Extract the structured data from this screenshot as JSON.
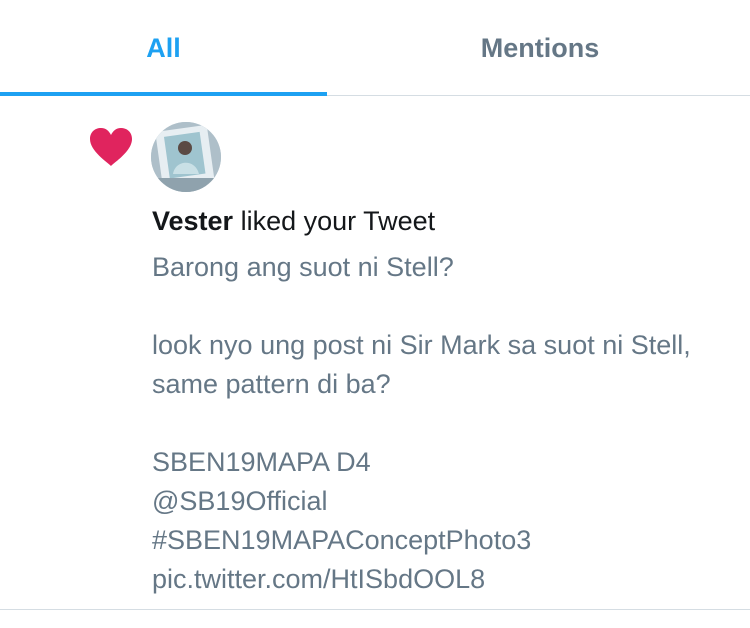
{
  "tabs": {
    "all_label": "All",
    "mentions_label": "Mentions",
    "active": "All"
  },
  "notification": {
    "icon": "heart-icon",
    "user_name": "Vester",
    "action_text": " liked your Tweet",
    "tweet_text": "Barong ang suot ni Stell?\n\nlook nyo ung post ni Sir Mark sa suot ni Stell, same pattern di ba?\n\nSBEN19MAPA D4\n@SB19Official\n#SBEN19MAPAConceptPhoto3\npic.twitter.com/HtISbdOOL8"
  },
  "colors": {
    "accent": "#1da1f2",
    "heart": "#e0245e",
    "secondary_text": "#657786",
    "primary_text": "#14171a",
    "divider": "#d5dde3"
  }
}
